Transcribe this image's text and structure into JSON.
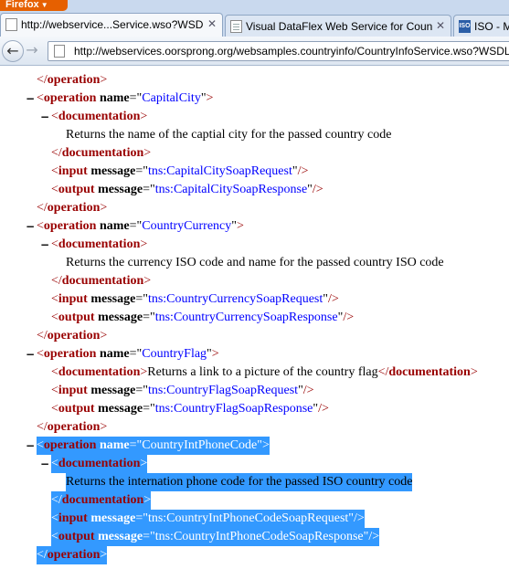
{
  "browser": {
    "app_button": "Firefox",
    "tabs": [
      {
        "title": "http://webservice...Service.wso?WSDL",
        "icon": "page-icon",
        "active": true
      },
      {
        "title": "Visual DataFlex Web Service for Coun...",
        "icon": "sheet-icon",
        "active": false
      },
      {
        "title": "ISO - M",
        "icon": "iso-icon",
        "active": false
      }
    ],
    "url": "http://webservices.oorsprong.org/websamples.countryinfo/CountryInfoService.wso?WSDL"
  },
  "xml": {
    "lines": [
      {
        "text": "</operation>"
      },
      {
        "text": "<operation name=\"CapitalCity\">"
      },
      {
        "text": "<documentation>"
      },
      {
        "text": "Returns the name of the captial city for the passed country code"
      },
      {
        "text": "</documentation>"
      },
      {
        "text": "<input message=\"tns:CapitalCitySoapRequest\"/>"
      },
      {
        "text": "<output message=\"tns:CapitalCitySoapResponse\"/>"
      },
      {
        "text": "</operation>"
      },
      {
        "text": "<operation name=\"CountryCurrency\">"
      },
      {
        "text": "<documentation>"
      },
      {
        "text": "Returns the currency ISO code and name for the passed country ISO code"
      },
      {
        "text": "</documentation>"
      },
      {
        "text": "<input message=\"tns:CountryCurrencySoapRequest\"/>"
      },
      {
        "text": "<output message=\"tns:CountryCurrencySoapResponse\"/>"
      },
      {
        "text": "</operation>"
      },
      {
        "text": "<operation name=\"CountryFlag\">"
      },
      {
        "text": "<documentation>Returns a link to a picture of the country flag</documentation>"
      },
      {
        "text": "<input message=\"tns:CountryFlagSoapRequest\"/>"
      },
      {
        "text": "<output message=\"tns:CountryFlagSoapResponse\"/>"
      },
      {
        "text": "</operation>"
      },
      {
        "text": "<operation name=\"CountryIntPhoneCode\">"
      },
      {
        "text": "<documentation>"
      },
      {
        "text": "Returns the internation phone code for the passed ISO country code"
      },
      {
        "text": "</documentation>"
      },
      {
        "text": "<input message=\"tns:CountryIntPhoneCodeSoapRequest\"/>"
      },
      {
        "text": "<output message=\"tns:CountryIntPhoneCodeSoapResponse\"/>"
      },
      {
        "text": "</operation>"
      }
    ],
    "collapse_marker": "−",
    "colors": {
      "bracket": "#990000",
      "tag": "#990000",
      "attr_value": "#0000ff",
      "selection": "#3399ff"
    }
  }
}
